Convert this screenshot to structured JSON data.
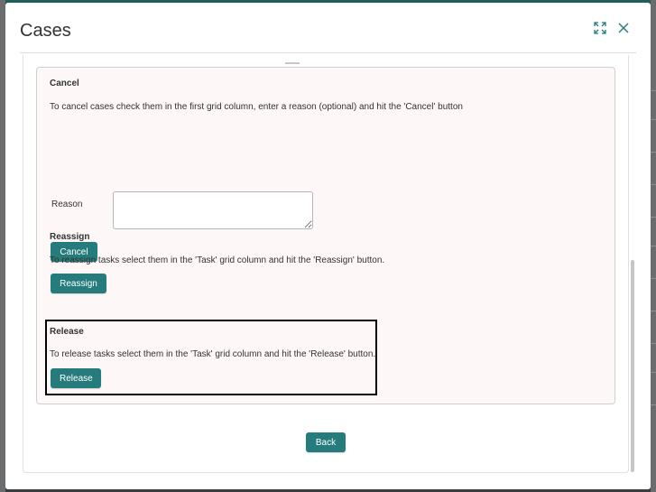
{
  "modal": {
    "title": "Cases"
  },
  "cancel_section": {
    "heading": "Cancel",
    "description": "To cancel cases check them in the first grid column, enter a reason (optional) and hit the 'Cancel' button",
    "reason_label": "Reason",
    "reason_value": "",
    "button_label": "Cancel"
  },
  "reassign_section": {
    "heading": "Reassign",
    "description": "To reassign tasks select them in the 'Task' grid column and hit the 'Reassign' button.",
    "button_label": "Reassign"
  },
  "release_section": {
    "heading": "Release",
    "description": "To release tasks select them in the 'Task' grid column and hit the 'Release' button.",
    "button_label": "Release"
  },
  "footer": {
    "back_label": "Back"
  },
  "colors": {
    "accent": "#267c7c",
    "panel_background": "#fdf8f7"
  },
  "icons": {
    "maximize": "expand-icon",
    "close": "close-icon"
  }
}
